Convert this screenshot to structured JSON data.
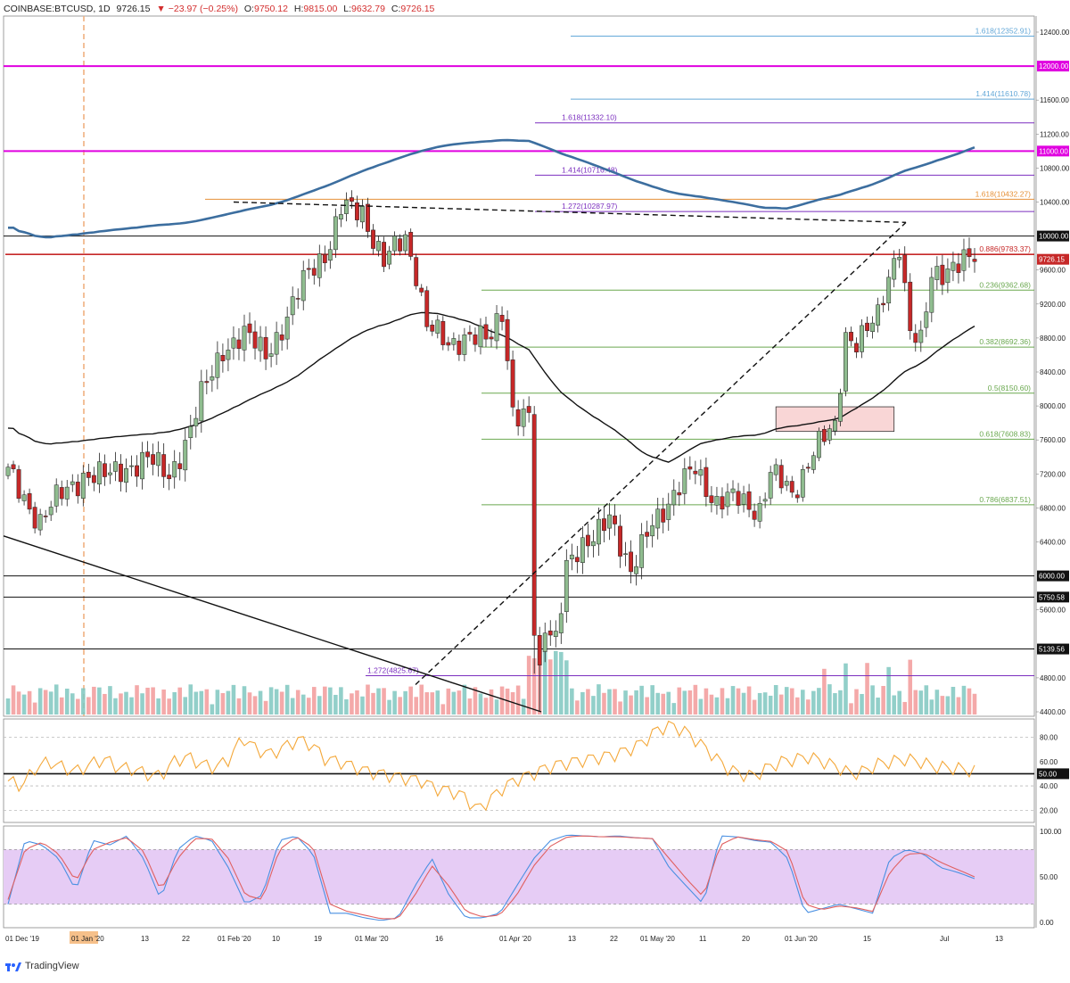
{
  "header": {
    "symbol": "COINBASE:BTCUSD, 1D",
    "last": "9726.15",
    "change": "▼ −23.97 (−0.25%)",
    "open_label": "O:",
    "open": "9750.12",
    "high_label": "H:",
    "high": "9815.00",
    "low_label": "L:",
    "low": "9632.79",
    "close_label": "C:",
    "close": "9726.15"
  },
  "footer": {
    "brand": "TradingView"
  },
  "colors": {
    "bull": "#8fbc8f",
    "bear": "#c62828",
    "ema_black": "#111111",
    "ema_blue": "#3c6e9f",
    "magenta": "#e000e0",
    "fib_green": "#6aa84f",
    "fib_purple": "#7b2fbf",
    "fib_blue": "#64a8d8",
    "fib_orange": "#e69138",
    "rsi": "#f4a83a",
    "stoch_k": "#4a90e2",
    "stoch_d": "#e06060",
    "stoch_band": "#e6ccf5",
    "vol_bull": "#7fc7c0",
    "vol_bear": "#f29a9a"
  },
  "chart_data": [
    {
      "type": "candlestick",
      "title": "",
      "ylim": [
        4400,
        12600
      ],
      "y_ticks": [
        "12400.00",
        "11600.00",
        "11200.00",
        "10800.00",
        "10400.00",
        "9600.00",
        "9200.00",
        "8800.00",
        "8400.00",
        "8000.00",
        "7600.00",
        "7200.00",
        "6800.00",
        "6400.00",
        "5600.00",
        "4800.00",
        "4400.00"
      ],
      "x_ticks": [
        "01 Dec '19",
        "01 Jan '20",
        "13",
        "22",
        "01 Feb '20",
        "10",
        "19",
        "01 Mar '20",
        "16",
        "01 Apr '20",
        "13",
        "22",
        "01 May '20",
        "11",
        "20",
        "01 Jun '20",
        "15",
        "Jul",
        "13"
      ],
      "horizontal_levels": [
        {
          "label": "12000.00",
          "value": 12000,
          "color": "magenta"
        },
        {
          "label": "11000.00",
          "value": 11000,
          "color": "magenta"
        },
        {
          "label": "10000.00",
          "value": 10000,
          "color": "black"
        },
        {
          "label": "6000.00",
          "value": 6000,
          "color": "black"
        },
        {
          "label": "5750.58",
          "value": 5750.58,
          "color": "black"
        },
        {
          "label": "5139.56",
          "value": 5139.56,
          "color": "black"
        }
      ],
      "price_label": {
        "label": "9726.15",
        "value": 9726.15
      },
      "fib_levels": [
        {
          "label": "1.618(12352.91)",
          "value": 12352.91,
          "color": "fib_blue"
        },
        {
          "label": "1.414(11610.78)",
          "value": 11610.78,
          "color": "fib_blue"
        },
        {
          "label": "1.618(11332.10)",
          "value": 11332.1,
          "color": "fib_purple"
        },
        {
          "label": "1.414(10716.48)",
          "value": 10716.48,
          "color": "fib_purple"
        },
        {
          "label": "1.618(10432.27)",
          "value": 10432.27,
          "color": "fib_orange"
        },
        {
          "label": "1.272(10287.97)",
          "value": 10287.97,
          "color": "fib_purple"
        },
        {
          "label": "0.886(9783.37)",
          "value": 9783.37,
          "color": "bear"
        },
        {
          "label": "0.236(9362.68)",
          "value": 9362.68,
          "color": "fib_green"
        },
        {
          "label": "0.382(8692.36)",
          "value": 8692.36,
          "color": "fib_green"
        },
        {
          "label": "0.5(8150.60)",
          "value": 8150.6,
          "color": "fib_green"
        },
        {
          "label": "0.618(7608.83)",
          "value": 7608.83,
          "color": "fib_green"
        },
        {
          "label": "0.786(6837.51)",
          "value": 6837.51,
          "color": "fib_green"
        },
        {
          "label": "1.272(4825.67)",
          "value": 4825.67,
          "color": "fib_purple"
        }
      ],
      "close_path": [
        [
          0,
          7200
        ],
        [
          6,
          6650
        ],
        [
          10,
          6950
        ],
        [
          14,
          7200
        ],
        [
          18,
          7150
        ],
        [
          22,
          7300
        ],
        [
          26,
          7350
        ],
        [
          30,
          7200
        ],
        [
          34,
          7700
        ],
        [
          36,
          8100
        ],
        [
          40,
          8700
        ],
        [
          44,
          8800
        ],
        [
          48,
          8650
        ],
        [
          52,
          9000
        ],
        [
          56,
          9600
        ],
        [
          60,
          9900
        ],
        [
          62,
          10300
        ],
        [
          66,
          10300
        ],
        [
          70,
          9700
        ],
        [
          74,
          9950
        ],
        [
          76,
          9600
        ],
        [
          78,
          9000
        ],
        [
          82,
          8650
        ],
        [
          86,
          8900
        ],
        [
          88,
          8800
        ],
        [
          90,
          8750
        ],
        [
          92,
          9100
        ],
        [
          94,
          8000
        ],
        [
          96,
          7900
        ],
        [
          97,
          7900
        ],
        [
          98,
          5300
        ],
        [
          99,
          4900
        ],
        [
          100,
          5350
        ],
        [
          102,
          5300
        ],
        [
          104,
          6200
        ],
        [
          108,
          6300
        ],
        [
          112,
          6800
        ],
        [
          116,
          5950
        ],
        [
          120,
          6700
        ],
        [
          124,
          6900
        ],
        [
          128,
          7300
        ],
        [
          132,
          6850
        ],
        [
          136,
          6900
        ],
        [
          140,
          6800
        ],
        [
          142,
          7200
        ],
        [
          146,
          6950
        ],
        [
          150,
          7500
        ],
        [
          154,
          7700
        ],
        [
          156,
          8850
        ],
        [
          158,
          8800
        ],
        [
          162,
          9000
        ],
        [
          164,
          9500
        ],
        [
          166,
          9950
        ],
        [
          168,
          8900
        ],
        [
          170,
          8700
        ],
        [
          172,
          9500
        ],
        [
          176,
          9700
        ],
        [
          180,
          9700
        ],
        [
          184,
          9000
        ],
        [
          186,
          8900
        ],
        [
          188,
          9100
        ],
        [
          190,
          9500
        ],
        [
          194,
          9700
        ],
        [
          196,
          10150
        ],
        [
          198,
          9400
        ],
        [
          200,
          9600
        ],
        [
          202,
          9750
        ],
        [
          204,
          9726
        ]
      ],
      "volume_profile": "daily volume histogram",
      "moving_averages": [
        "EMA 100 (black)",
        "SMA 200 (blue)"
      ]
    },
    {
      "type": "line",
      "title": "",
      "ylim": [
        10,
        95
      ],
      "y_ticks": [
        "80.00",
        "60.00",
        "40.00",
        "20.00"
      ],
      "reference_level": {
        "label": "50.00",
        "value": 50
      },
      "series": [
        {
          "values": [
            44,
            40,
            55,
            60,
            55,
            52,
            58,
            62,
            55,
            54,
            50,
            48,
            60,
            64,
            58,
            55,
            62,
            80,
            70,
            66,
            72,
            78,
            74,
            62,
            60,
            56,
            52,
            50,
            48,
            46,
            44,
            38,
            36,
            32,
            20,
            30,
            40,
            46,
            50,
            55,
            58,
            60,
            62,
            64,
            66,
            70,
            76,
            86,
            90,
            85,
            76,
            66,
            55,
            50,
            48,
            55,
            60,
            62,
            64,
            60,
            56,
            50,
            52,
            58,
            60,
            62,
            60,
            56,
            55,
            54,
            52
          ]
        }
      ]
    },
    {
      "type": "line",
      "title": "",
      "ylim": [
        0,
        100
      ],
      "y_ticks": [
        "100.00",
        "50.00",
        "0.00"
      ],
      "band": [
        20,
        80
      ],
      "series": [
        {
          "values": [
            20,
            90,
            85,
            70,
            35,
            90,
            85,
            95,
            70,
            25,
            80,
            95,
            90,
            60,
            20,
            30,
            90,
            95,
            75,
            10,
            10,
            5,
            2,
            5,
            40,
            70,
            30,
            5,
            5,
            10,
            40,
            70,
            90,
            96,
            95,
            94,
            95,
            93,
            92,
            60,
            40,
            20,
            95,
            94,
            90,
            88,
            70,
            10,
            15,
            20,
            15,
            10,
            70,
            80,
            75,
            60,
            55,
            48
          ]
        },
        {
          "values": [
            25,
            80,
            88,
            75,
            45,
            80,
            88,
            93,
            78,
            35,
            70,
            92,
            92,
            70,
            30,
            25,
            80,
            94,
            82,
            20,
            12,
            8,
            4,
            4,
            30,
            62,
            40,
            12,
            6,
            8,
            30,
            62,
            84,
            94,
            95,
            94,
            94,
            93,
            92,
            70,
            48,
            28,
            85,
            94,
            91,
            89,
            78,
            20,
            14,
            18,
            16,
            12,
            55,
            75,
            76,
            66,
            58,
            50
          ]
        }
      ]
    }
  ]
}
